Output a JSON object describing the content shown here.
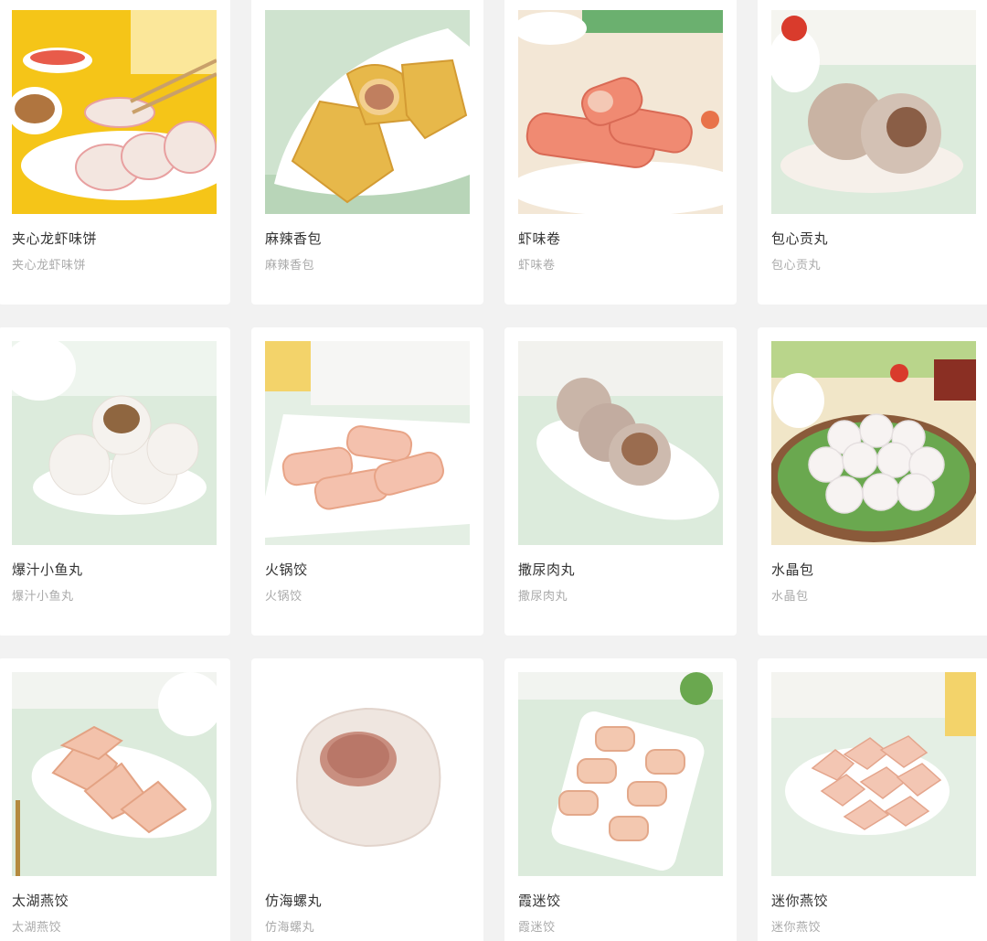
{
  "products": [
    {
      "name": "夹心龙虾味饼",
      "desc": "夹心龙虾味饼",
      "image": "crab-cake-image",
      "bg": "#f5c518",
      "plate": "#ffffff",
      "food": "#f3e6e0"
    },
    {
      "name": "麻辣香包",
      "desc": "麻辣香包",
      "image": "fried-tofu-pouch-image",
      "bg": "#cfe3cf",
      "plate": "#ffffff",
      "food": "#e7b84a"
    },
    {
      "name": "虾味卷",
      "desc": "虾味卷",
      "image": "shrimp-roll-image",
      "bg": "#f3e7d6",
      "plate": "#ffffff",
      "food": "#f08a72"
    },
    {
      "name": "包心贡丸",
      "desc": "包心贡丸",
      "image": "stuffed-meatball-image",
      "bg": "#dcebdc",
      "plate": "#f6f0ea",
      "food": "#c9b3a3"
    },
    {
      "name": "爆汁小鱼丸",
      "desc": "爆汁小鱼丸",
      "image": "fish-ball-image",
      "bg": "#dcebdc",
      "plate": "#ffffff",
      "food": "#f5f2ee"
    },
    {
      "name": "火锅饺",
      "desc": "火锅饺",
      "image": "hotpot-dumpling-image",
      "bg": "#e4efe4",
      "plate": "#ffffff",
      "food": "#f4c1ad"
    },
    {
      "name": "撒尿肉丸",
      "desc": "撒尿肉丸",
      "image": "pork-ball-image",
      "bg": "#dcebdc",
      "plate": "#ffffff",
      "food": "#c9b5a8"
    },
    {
      "name": "水晶包",
      "desc": "水晶包",
      "image": "crystal-bun-image",
      "bg": "#f1e6c8",
      "plate": "#6aa84f",
      "food": "#f7f3f2"
    },
    {
      "name": "太湖燕饺",
      "desc": "太湖燕饺",
      "image": "taihu-dumpling-image",
      "bg": "#dcebdc",
      "plate": "#ffffff",
      "food": "#f3c2ab"
    },
    {
      "name": "仿海螺丸",
      "desc": "仿海螺丸",
      "image": "conch-ball-image",
      "bg": "#ffffff",
      "plate": "#ffffff",
      "food": "#efe6e0"
    },
    {
      "name": "霞迷饺",
      "desc": "霞迷饺",
      "image": "shrimp-dumpling-image",
      "bg": "#dcebdc",
      "plate": "#ffffff",
      "food": "#f3c8b0"
    },
    {
      "name": "迷你燕饺",
      "desc": "迷你燕饺",
      "image": "mini-dumpling-image",
      "bg": "#e4efe4",
      "plate": "#ffffff",
      "food": "#f3c6b3"
    }
  ]
}
